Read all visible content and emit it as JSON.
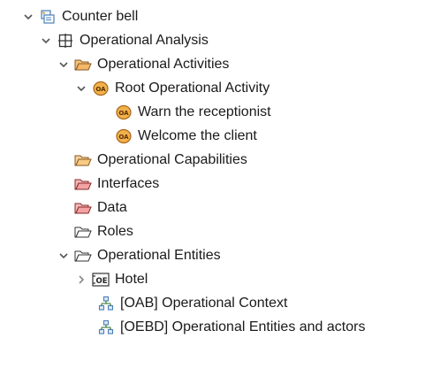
{
  "tree": {
    "nodes": [
      {
        "label": "Counter bell",
        "icon": "project-icon",
        "twisty": "expanded"
      },
      {
        "label": "Operational Analysis",
        "icon": "grid-icon",
        "twisty": "expanded"
      },
      {
        "label": "Operational Activities",
        "icon": "folder-open-orange-icon",
        "twisty": "expanded"
      },
      {
        "label": "Root Operational Activity",
        "icon": "operational-activity-icon",
        "twisty": "expanded"
      },
      {
        "label": "Warn the receptionist",
        "icon": "operational-activity-icon",
        "twisty": "none"
      },
      {
        "label": "Welcome the client",
        "icon": "operational-activity-icon",
        "twisty": "none"
      },
      {
        "label": "Operational Capabilities",
        "icon": "folder-orange-icon",
        "twisty": "none"
      },
      {
        "label": "Interfaces",
        "icon": "folder-red-icon",
        "twisty": "none"
      },
      {
        "label": "Data",
        "icon": "folder-red-icon",
        "twisty": "none"
      },
      {
        "label": "Roles",
        "icon": "folder-gray-icon",
        "twisty": "none"
      },
      {
        "label": "Operational Entities",
        "icon": "folder-gray-icon",
        "twisty": "expanded"
      },
      {
        "label": "Hotel",
        "icon": "operational-entity-icon",
        "twisty": "collapsed"
      },
      {
        "label": "[OAB] Operational Context",
        "icon": "diagram-icon",
        "twisty": "none"
      },
      {
        "label": "[OEBD] Operational Entities and actors",
        "icon": "diagram-icon",
        "twisty": "none"
      }
    ],
    "icon_labels": {
      "operational_activity": "OA",
      "operational_entity": "OE"
    },
    "colors": {
      "text": "#1a1a1a",
      "twisty": "#555555",
      "activity_fill": "#f2b04a",
      "activity_stroke": "#a8661a",
      "folder_orange": "#f4b86a",
      "folder_red": "#f3a3a3",
      "folder_gray": "#ffffff",
      "diagram": "#4a7fb8"
    }
  }
}
